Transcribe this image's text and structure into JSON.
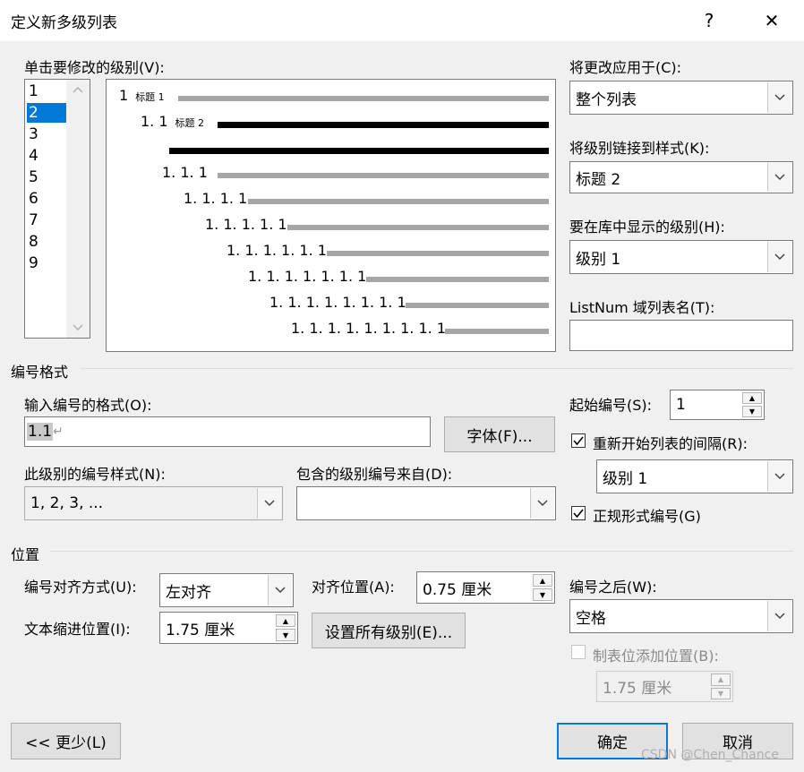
{
  "dialog": {
    "title": "定义新多级列表",
    "help": "?",
    "close": "✕"
  },
  "levels_label": "单击要修改的级别(V):",
  "levels": [
    "1",
    "2",
    "3",
    "4",
    "5",
    "6",
    "7",
    "8",
    "9"
  ],
  "selected_level": "2",
  "preview": {
    "rows": [
      {
        "num": "1",
        "tag": "标题 1"
      },
      {
        "num": "1. 1",
        "tag": "标题 2"
      },
      {
        "num": "1. 1. 1",
        "tag": ""
      },
      {
        "num": "1. 1. 1. 1",
        "tag": ""
      },
      {
        "num": "1. 1. 1. 1. 1",
        "tag": ""
      },
      {
        "num": "1. 1. 1. 1. 1. 1",
        "tag": ""
      },
      {
        "num": "1. 1. 1. 1. 1. 1. 1",
        "tag": ""
      },
      {
        "num": "1. 1. 1. 1. 1. 1. 1. 1",
        "tag": ""
      },
      {
        "num": "1. 1. 1. 1. 1. 1. 1. 1. 1",
        "tag": ""
      }
    ]
  },
  "right_panel": {
    "apply_label": "将更改应用于(C):",
    "apply_value": "整个列表",
    "link_label": "将级别链接到样式(K):",
    "link_value": "标题 2",
    "gallery_label": "要在库中显示的级别(H):",
    "gallery_value": "级别 1",
    "listnum_label": "ListNum 域列表名(T):",
    "listnum_value": ""
  },
  "number_format": {
    "group_title": "编号格式",
    "format_label": "输入编号的格式(O):",
    "format_value": "1.1",
    "format_mark": "↵",
    "font_button": "字体(F)...",
    "style_label": "此级别的编号样式(N):",
    "style_value": "1, 2, 3, ...",
    "include_label": "包含的级别编号来自(D):",
    "include_value": "",
    "start_label": "起始编号(S):",
    "start_value": "1",
    "restart_label": "重新开始列表的间隔(R):",
    "restart_checked": true,
    "restart_value": "级别 1",
    "legal_label": "正规形式编号(G)",
    "legal_checked": true
  },
  "position": {
    "group_title": "位置",
    "align_label": "编号对齐方式(U):",
    "align_value": "左对齐",
    "at_label": "对齐位置(A):",
    "at_value": "0.75 厘米",
    "indent_label": "文本缩进位置(I):",
    "indent_value": "1.75 厘米",
    "set_all_button": "设置所有级别(E)...",
    "follow_label": "编号之后(W):",
    "follow_value": "空格",
    "tab_label": "制表位添加位置(B):",
    "tab_checked": false,
    "tab_value": "1.75 厘米"
  },
  "footer": {
    "less_button": "<< 更少(L)",
    "ok_button": "确定",
    "cancel_button": "取消",
    "watermark": "CSDN @Chen_Chance"
  }
}
